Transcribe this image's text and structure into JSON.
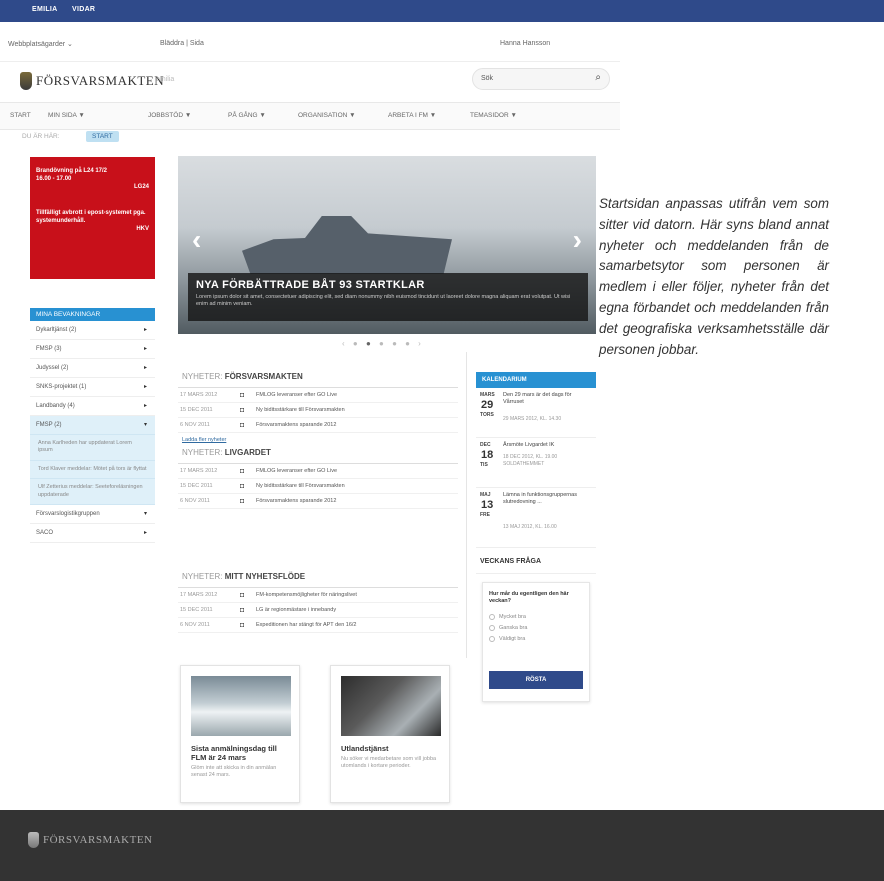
{
  "topbar": {
    "tabs": [
      "EMILIA",
      "VIDAR"
    ],
    "color": "#2f4a8a"
  },
  "subbar": {
    "left": "Webbplatsägarder  ⌄",
    "mid": "Bläddra  |  Sida",
    "user": "Hanna Hansson"
  },
  "header": {
    "logo": "FÖRSVARSMAKTEN",
    "username": "emilia",
    "search_placeholder": "Sök"
  },
  "nav": [
    "START",
    "MIN SIDA ▼",
    "JOBBSTÖD ▼",
    "PÅ GÅNG ▼",
    "ORGANISATION ▼",
    "ARBETA I FM ▼",
    "TEMASIDOR ▼"
  ],
  "breadcrumb": {
    "label": "DU ÄR HÄR:",
    "current": "START"
  },
  "alerts": {
    "a1": "Brandövning på L24 17/2",
    "a1_time": "16.00 - 17.00",
    "a1_src": "LG24",
    "a2": "Tillfälligt avbrott i epost-systemet pga. systemunderhåll.",
    "a2_src": "HKV",
    "color": "#c8101a"
  },
  "bevakningar": {
    "title": "MINA BEVAKNINGAR",
    "items": [
      "Dykarltjänst (2)",
      "FMSP (3)",
      "Judyssel (2)",
      "SNKS-projektet (1)",
      "Landbandy (4)"
    ],
    "expanded_label": "FMSP (2)",
    "expanded_subs": [
      "Anna Karlheden har uppdaterat Lorem ipsum",
      "Tord Klaver meddelar: Mötet på tors är flyttat",
      "Ulf Zetterius meddelar: Seeteforeläsningen uppdaterade"
    ],
    "more_items": [
      "Försvarslogistikgruppen",
      "SACO"
    ]
  },
  "hero": {
    "headline": "NYA FÖRBÄTTRADE BÅT 93 STARTKLAR",
    "desc": "Lorem ipsum dolor sit amet, consectetuer adipiscing elit, sed diam nonummy nibh euismod tincidunt ut laoreet dolore magna aliquam erat volutpat. Ut wisi enim ad minim veniam."
  },
  "news": [
    {
      "prefix": "NYHETER:",
      "name": "FÖRSVARSMAKTEN",
      "rows": [
        {
          "date": "17 MARS 2012",
          "text": "FMLOG leveranser efter GO Live"
        },
        {
          "date": "15 DEC 2011",
          "text": "Ny biditsstärkare till Försvarsmakten"
        },
        {
          "date": "6 NOV 2011",
          "text": "Försvarsmaktens sparande 2012"
        }
      ],
      "more": "Ladda fler nyheter"
    },
    {
      "prefix": "NYHETER:",
      "name": "LIVGARDET",
      "rows": [
        {
          "date": "17 MARS 2012",
          "text": "FMLOG leveranser efter GO Live"
        },
        {
          "date": "15 DEC 2011",
          "text": "Ny biditsstärkare till Försvarsmakten"
        },
        {
          "date": "6 NOV 2011",
          "text": "Försvarsmaktens sparande 2012"
        }
      ]
    },
    {
      "prefix": "NYHETER:",
      "name": "MITT NYHETSFLÖDE",
      "rows": [
        {
          "date": "17 MARS 2012",
          "text": "FM-kompetensmöjligheter för näringslivet"
        },
        {
          "date": "15 DEC 2011",
          "text": "LG är regionmästare i innebandy"
        },
        {
          "date": "6 NOV 2011",
          "text": "Expeditionen har stängt för APT den 16/2"
        }
      ]
    }
  ],
  "kalendarium": {
    "title": "KALENDARIUM",
    "events": [
      {
        "month": "MARS",
        "day": "29",
        "weekday": "TORS",
        "title": "Den 29 mars är det dags för Vårruset",
        "time": "29 MARS 2012, KL. 14.30"
      },
      {
        "month": "DEC",
        "day": "18",
        "weekday": "TIS",
        "title": "Årsmöte Livgardet IK",
        "time": "18 DEC 2012, KL. 19.00 SOLDATHEMMET"
      },
      {
        "month": "MAJ",
        "day": "13",
        "weekday": "FRE",
        "title": "Lämna in funktionsgruppernas slutredovning ...",
        "time": "13 MAJ 2012, KL. 16.00"
      }
    ]
  },
  "veckans_fraga": {
    "title": "VECKANS FRÅGA",
    "question": "Hur mår du egentligen den här veckan?",
    "options": [
      "Mycket bra",
      "Ganska bra",
      "Väldigt bra"
    ],
    "button": "RÖSTA"
  },
  "cards": [
    {
      "title": "Sista anmälningsdag till FLM är 24 mars",
      "desc": "Glöm inte att skicka in din anmälan senast 24 mars."
    },
    {
      "title": "Utlandstjänst",
      "desc": "Nu söker vi medarbetare som vill jobba utomlands i kortare perioder."
    }
  ],
  "sidetext": "Startsidan anpassas utifrån vem som sitter vid datorn. Här syns bland annat nyheter och meddelanden från de samarbetsytor som personen är medlem i eller följer, nyheter från det egna förbandet och meddelanden från det geografiska verksamhetsställe där personen jobbar.",
  "footer": {
    "logo": "FÖRSVARSMAKTEN"
  }
}
